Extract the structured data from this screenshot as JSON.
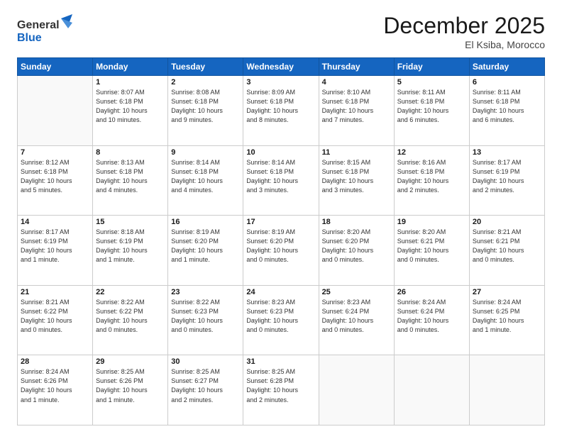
{
  "header": {
    "logo_general": "General",
    "logo_blue": "Blue",
    "title": "December 2025",
    "location": "El Ksiba, Morocco"
  },
  "days_of_week": [
    "Sunday",
    "Monday",
    "Tuesday",
    "Wednesday",
    "Thursday",
    "Friday",
    "Saturday"
  ],
  "weeks": [
    [
      {
        "num": "",
        "info": ""
      },
      {
        "num": "1",
        "info": "Sunrise: 8:07 AM\nSunset: 6:18 PM\nDaylight: 10 hours\nand 10 minutes."
      },
      {
        "num": "2",
        "info": "Sunrise: 8:08 AM\nSunset: 6:18 PM\nDaylight: 10 hours\nand 9 minutes."
      },
      {
        "num": "3",
        "info": "Sunrise: 8:09 AM\nSunset: 6:18 PM\nDaylight: 10 hours\nand 8 minutes."
      },
      {
        "num": "4",
        "info": "Sunrise: 8:10 AM\nSunset: 6:18 PM\nDaylight: 10 hours\nand 7 minutes."
      },
      {
        "num": "5",
        "info": "Sunrise: 8:11 AM\nSunset: 6:18 PM\nDaylight: 10 hours\nand 6 minutes."
      },
      {
        "num": "6",
        "info": "Sunrise: 8:11 AM\nSunset: 6:18 PM\nDaylight: 10 hours\nand 6 minutes."
      }
    ],
    [
      {
        "num": "7",
        "info": "Sunrise: 8:12 AM\nSunset: 6:18 PM\nDaylight: 10 hours\nand 5 minutes."
      },
      {
        "num": "8",
        "info": "Sunrise: 8:13 AM\nSunset: 6:18 PM\nDaylight: 10 hours\nand 4 minutes."
      },
      {
        "num": "9",
        "info": "Sunrise: 8:14 AM\nSunset: 6:18 PM\nDaylight: 10 hours\nand 4 minutes."
      },
      {
        "num": "10",
        "info": "Sunrise: 8:14 AM\nSunset: 6:18 PM\nDaylight: 10 hours\nand 3 minutes."
      },
      {
        "num": "11",
        "info": "Sunrise: 8:15 AM\nSunset: 6:18 PM\nDaylight: 10 hours\nand 3 minutes."
      },
      {
        "num": "12",
        "info": "Sunrise: 8:16 AM\nSunset: 6:18 PM\nDaylight: 10 hours\nand 2 minutes."
      },
      {
        "num": "13",
        "info": "Sunrise: 8:17 AM\nSunset: 6:19 PM\nDaylight: 10 hours\nand 2 minutes."
      }
    ],
    [
      {
        "num": "14",
        "info": "Sunrise: 8:17 AM\nSunset: 6:19 PM\nDaylight: 10 hours\nand 1 minute."
      },
      {
        "num": "15",
        "info": "Sunrise: 8:18 AM\nSunset: 6:19 PM\nDaylight: 10 hours\nand 1 minute."
      },
      {
        "num": "16",
        "info": "Sunrise: 8:19 AM\nSunset: 6:20 PM\nDaylight: 10 hours\nand 1 minute."
      },
      {
        "num": "17",
        "info": "Sunrise: 8:19 AM\nSunset: 6:20 PM\nDaylight: 10 hours\nand 0 minutes."
      },
      {
        "num": "18",
        "info": "Sunrise: 8:20 AM\nSunset: 6:20 PM\nDaylight: 10 hours\nand 0 minutes."
      },
      {
        "num": "19",
        "info": "Sunrise: 8:20 AM\nSunset: 6:21 PM\nDaylight: 10 hours\nand 0 minutes."
      },
      {
        "num": "20",
        "info": "Sunrise: 8:21 AM\nSunset: 6:21 PM\nDaylight: 10 hours\nand 0 minutes."
      }
    ],
    [
      {
        "num": "21",
        "info": "Sunrise: 8:21 AM\nSunset: 6:22 PM\nDaylight: 10 hours\nand 0 minutes."
      },
      {
        "num": "22",
        "info": "Sunrise: 8:22 AM\nSunset: 6:22 PM\nDaylight: 10 hours\nand 0 minutes."
      },
      {
        "num": "23",
        "info": "Sunrise: 8:22 AM\nSunset: 6:23 PM\nDaylight: 10 hours\nand 0 minutes."
      },
      {
        "num": "24",
        "info": "Sunrise: 8:23 AM\nSunset: 6:23 PM\nDaylight: 10 hours\nand 0 minutes."
      },
      {
        "num": "25",
        "info": "Sunrise: 8:23 AM\nSunset: 6:24 PM\nDaylight: 10 hours\nand 0 minutes."
      },
      {
        "num": "26",
        "info": "Sunrise: 8:24 AM\nSunset: 6:24 PM\nDaylight: 10 hours\nand 0 minutes."
      },
      {
        "num": "27",
        "info": "Sunrise: 8:24 AM\nSunset: 6:25 PM\nDaylight: 10 hours\nand 1 minute."
      }
    ],
    [
      {
        "num": "28",
        "info": "Sunrise: 8:24 AM\nSunset: 6:26 PM\nDaylight: 10 hours\nand 1 minute."
      },
      {
        "num": "29",
        "info": "Sunrise: 8:25 AM\nSunset: 6:26 PM\nDaylight: 10 hours\nand 1 minute."
      },
      {
        "num": "30",
        "info": "Sunrise: 8:25 AM\nSunset: 6:27 PM\nDaylight: 10 hours\nand 2 minutes."
      },
      {
        "num": "31",
        "info": "Sunrise: 8:25 AM\nSunset: 6:28 PM\nDaylight: 10 hours\nand 2 minutes."
      },
      {
        "num": "",
        "info": ""
      },
      {
        "num": "",
        "info": ""
      },
      {
        "num": "",
        "info": ""
      }
    ]
  ]
}
